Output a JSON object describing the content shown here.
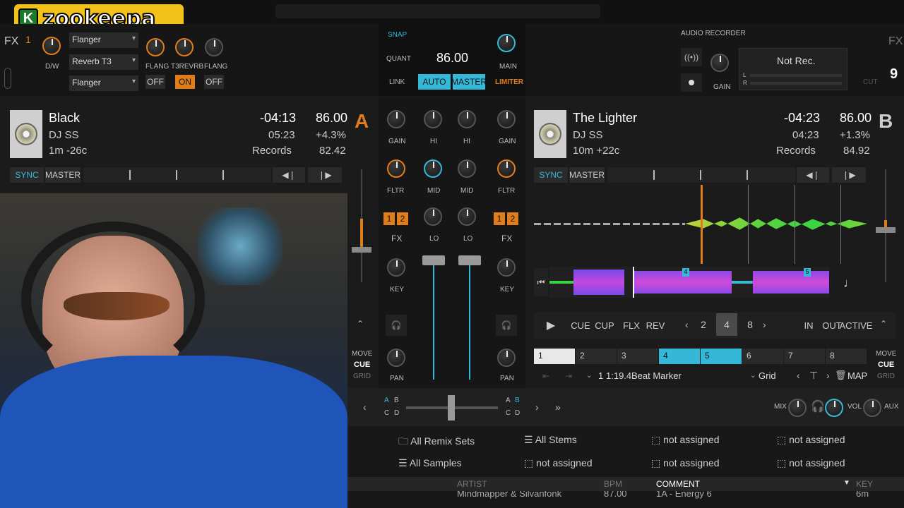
{
  "overlay": {
    "logo_letter": "K",
    "logo_text": "zookeepa"
  },
  "fx": {
    "left_label": "FX",
    "right_label": "FX",
    "unit_num": "1",
    "dw_label": "D/W",
    "slots": [
      "Flanger",
      "Reverb T3",
      "Flanger"
    ],
    "knob_labels": [
      "FLANG",
      "T3REVRB",
      "FLANG"
    ],
    "buttons": [
      "OFF",
      "ON",
      "OFF"
    ]
  },
  "master": {
    "snap": "SNAP",
    "quant": "QUANT",
    "bpm": "86.00",
    "link": "LINK",
    "auto": "AUTO",
    "master_btn": "MASTER",
    "main": "MAIN",
    "limiter": "LIMITER"
  },
  "recorder": {
    "title": "AUDIO RECORDER",
    "status": "Not Rec.",
    "gain": "GAIN",
    "l": "L",
    "r": "R",
    "cut": "CUT"
  },
  "deck_a": {
    "letter": "A",
    "title": "Black",
    "artist": "DJ SS",
    "key": "1m -26c",
    "time_remaining": "-04:13",
    "time_elapsed": "05:23",
    "label": "Records",
    "bpm": "86.00",
    "pitch": "+4.3%",
    "original_bpm": "82.42",
    "sync": "SYNC",
    "master_btn": "MASTER"
  },
  "deck_b": {
    "letter": "B",
    "title": "The Lighter",
    "artist": "DJ SS",
    "key": "10m +22c",
    "time_remaining": "-04:23",
    "time_elapsed": "04:23",
    "label": "Records",
    "bpm": "86.00",
    "pitch": "+1.3%",
    "original_bpm": "84.92",
    "sync": "SYNC",
    "master_btn": "MASTER",
    "transport": {
      "cue": "CUE",
      "cup": "CUP",
      "flx": "FLX",
      "rev": "REV",
      "loop_sizes": [
        "2",
        "4",
        "8"
      ],
      "in": "IN",
      "out": "OUT",
      "active": "ACTIVE"
    },
    "cue_slots": [
      "1",
      "2",
      "3",
      "4",
      "5",
      "6",
      "7",
      "8"
    ],
    "cue_info": {
      "num": "1",
      "time": "1:19.4",
      "type": "Beat Marker",
      "grid": "Grid",
      "map": "MAP"
    },
    "move": "MOVE",
    "move_cue": "CUE",
    "move_grid": "GRID",
    "marker_labels": [
      "4",
      "5"
    ]
  },
  "mixer": {
    "gain": "GAIN",
    "hi": "HI",
    "mid": "MID",
    "lo": "LO",
    "fltr": "FLTR",
    "fx": "FX",
    "key": "KEY",
    "pan": "PAN",
    "fx_1": "1",
    "fx_2": "2",
    "move": "MOVE",
    "move_cue": "CUE",
    "move_grid": "GRID",
    "xfader_a": "A",
    "xfader_b": "B",
    "xfader_c": "C",
    "xfader_d": "D"
  },
  "headphone": {
    "mix": "MIX",
    "vol": "VOL",
    "aux": "AUX"
  },
  "browser": {
    "row1": [
      "All Remix Sets",
      "All Stems",
      "not assigned",
      "not assigned"
    ],
    "row2": [
      "All Samples",
      "not assigned",
      "not assigned",
      "not assigned"
    ],
    "columns": [
      "ARTIST",
      "BPM",
      "COMMENT",
      "KEY"
    ],
    "partial_row": [
      "Mindmapper & Silvanfonk",
      "87.00",
      "1A - Energy 6",
      "6m"
    ]
  }
}
